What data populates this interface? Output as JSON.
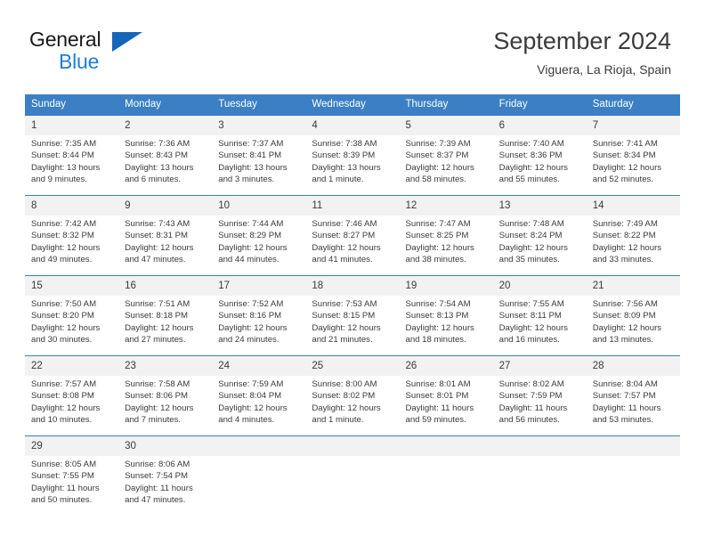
{
  "brand": {
    "name_part1": "General",
    "name_part2": "Blue",
    "triangle_color": "#1565b8",
    "blue_text_color": "#1f7fd4"
  },
  "header": {
    "title": "September 2024",
    "subtitle": "Viguera, La Rioja, Spain"
  },
  "theme": {
    "header_row_bg": "#3b7fc4",
    "day_number_bg": "#f2f2f2",
    "text_color": "#3a3a3a"
  },
  "calendar": {
    "weekday_headers": [
      "Sunday",
      "Monday",
      "Tuesday",
      "Wednesday",
      "Thursday",
      "Friday",
      "Saturday"
    ],
    "weeks": [
      [
        {
          "day": "1",
          "sunrise": "Sunrise: 7:35 AM",
          "sunset": "Sunset: 8:44 PM",
          "daylight_line1": "Daylight: 13 hours",
          "daylight_line2": "and 9 minutes."
        },
        {
          "day": "2",
          "sunrise": "Sunrise: 7:36 AM",
          "sunset": "Sunset: 8:43 PM",
          "daylight_line1": "Daylight: 13 hours",
          "daylight_line2": "and 6 minutes."
        },
        {
          "day": "3",
          "sunrise": "Sunrise: 7:37 AM",
          "sunset": "Sunset: 8:41 PM",
          "daylight_line1": "Daylight: 13 hours",
          "daylight_line2": "and 3 minutes."
        },
        {
          "day": "4",
          "sunrise": "Sunrise: 7:38 AM",
          "sunset": "Sunset: 8:39 PM",
          "daylight_line1": "Daylight: 13 hours",
          "daylight_line2": "and 1 minute."
        },
        {
          "day": "5",
          "sunrise": "Sunrise: 7:39 AM",
          "sunset": "Sunset: 8:37 PM",
          "daylight_line1": "Daylight: 12 hours",
          "daylight_line2": "and 58 minutes."
        },
        {
          "day": "6",
          "sunrise": "Sunrise: 7:40 AM",
          "sunset": "Sunset: 8:36 PM",
          "daylight_line1": "Daylight: 12 hours",
          "daylight_line2": "and 55 minutes."
        },
        {
          "day": "7",
          "sunrise": "Sunrise: 7:41 AM",
          "sunset": "Sunset: 8:34 PM",
          "daylight_line1": "Daylight: 12 hours",
          "daylight_line2": "and 52 minutes."
        }
      ],
      [
        {
          "day": "8",
          "sunrise": "Sunrise: 7:42 AM",
          "sunset": "Sunset: 8:32 PM",
          "daylight_line1": "Daylight: 12 hours",
          "daylight_line2": "and 49 minutes."
        },
        {
          "day": "9",
          "sunrise": "Sunrise: 7:43 AM",
          "sunset": "Sunset: 8:31 PM",
          "daylight_line1": "Daylight: 12 hours",
          "daylight_line2": "and 47 minutes."
        },
        {
          "day": "10",
          "sunrise": "Sunrise: 7:44 AM",
          "sunset": "Sunset: 8:29 PM",
          "daylight_line1": "Daylight: 12 hours",
          "daylight_line2": "and 44 minutes."
        },
        {
          "day": "11",
          "sunrise": "Sunrise: 7:46 AM",
          "sunset": "Sunset: 8:27 PM",
          "daylight_line1": "Daylight: 12 hours",
          "daylight_line2": "and 41 minutes."
        },
        {
          "day": "12",
          "sunrise": "Sunrise: 7:47 AM",
          "sunset": "Sunset: 8:25 PM",
          "daylight_line1": "Daylight: 12 hours",
          "daylight_line2": "and 38 minutes."
        },
        {
          "day": "13",
          "sunrise": "Sunrise: 7:48 AM",
          "sunset": "Sunset: 8:24 PM",
          "daylight_line1": "Daylight: 12 hours",
          "daylight_line2": "and 35 minutes."
        },
        {
          "day": "14",
          "sunrise": "Sunrise: 7:49 AM",
          "sunset": "Sunset: 8:22 PM",
          "daylight_line1": "Daylight: 12 hours",
          "daylight_line2": "and 33 minutes."
        }
      ],
      [
        {
          "day": "15",
          "sunrise": "Sunrise: 7:50 AM",
          "sunset": "Sunset: 8:20 PM",
          "daylight_line1": "Daylight: 12 hours",
          "daylight_line2": "and 30 minutes."
        },
        {
          "day": "16",
          "sunrise": "Sunrise: 7:51 AM",
          "sunset": "Sunset: 8:18 PM",
          "daylight_line1": "Daylight: 12 hours",
          "daylight_line2": "and 27 minutes."
        },
        {
          "day": "17",
          "sunrise": "Sunrise: 7:52 AM",
          "sunset": "Sunset: 8:16 PM",
          "daylight_line1": "Daylight: 12 hours",
          "daylight_line2": "and 24 minutes."
        },
        {
          "day": "18",
          "sunrise": "Sunrise: 7:53 AM",
          "sunset": "Sunset: 8:15 PM",
          "daylight_line1": "Daylight: 12 hours",
          "daylight_line2": "and 21 minutes."
        },
        {
          "day": "19",
          "sunrise": "Sunrise: 7:54 AM",
          "sunset": "Sunset: 8:13 PM",
          "daylight_line1": "Daylight: 12 hours",
          "daylight_line2": "and 18 minutes."
        },
        {
          "day": "20",
          "sunrise": "Sunrise: 7:55 AM",
          "sunset": "Sunset: 8:11 PM",
          "daylight_line1": "Daylight: 12 hours",
          "daylight_line2": "and 16 minutes."
        },
        {
          "day": "21",
          "sunrise": "Sunrise: 7:56 AM",
          "sunset": "Sunset: 8:09 PM",
          "daylight_line1": "Daylight: 12 hours",
          "daylight_line2": "and 13 minutes."
        }
      ],
      [
        {
          "day": "22",
          "sunrise": "Sunrise: 7:57 AM",
          "sunset": "Sunset: 8:08 PM",
          "daylight_line1": "Daylight: 12 hours",
          "daylight_line2": "and 10 minutes."
        },
        {
          "day": "23",
          "sunrise": "Sunrise: 7:58 AM",
          "sunset": "Sunset: 8:06 PM",
          "daylight_line1": "Daylight: 12 hours",
          "daylight_line2": "and 7 minutes."
        },
        {
          "day": "24",
          "sunrise": "Sunrise: 7:59 AM",
          "sunset": "Sunset: 8:04 PM",
          "daylight_line1": "Daylight: 12 hours",
          "daylight_line2": "and 4 minutes."
        },
        {
          "day": "25",
          "sunrise": "Sunrise: 8:00 AM",
          "sunset": "Sunset: 8:02 PM",
          "daylight_line1": "Daylight: 12 hours",
          "daylight_line2": "and 1 minute."
        },
        {
          "day": "26",
          "sunrise": "Sunrise: 8:01 AM",
          "sunset": "Sunset: 8:01 PM",
          "daylight_line1": "Daylight: 11 hours",
          "daylight_line2": "and 59 minutes."
        },
        {
          "day": "27",
          "sunrise": "Sunrise: 8:02 AM",
          "sunset": "Sunset: 7:59 PM",
          "daylight_line1": "Daylight: 11 hours",
          "daylight_line2": "and 56 minutes."
        },
        {
          "day": "28",
          "sunrise": "Sunrise: 8:04 AM",
          "sunset": "Sunset: 7:57 PM",
          "daylight_line1": "Daylight: 11 hours",
          "daylight_line2": "and 53 minutes."
        }
      ],
      [
        {
          "day": "29",
          "sunrise": "Sunrise: 8:05 AM",
          "sunset": "Sunset: 7:55 PM",
          "daylight_line1": "Daylight: 11 hours",
          "daylight_line2": "and 50 minutes."
        },
        {
          "day": "30",
          "sunrise": "Sunrise: 8:06 AM",
          "sunset": "Sunset: 7:54 PM",
          "daylight_line1": "Daylight: 11 hours",
          "daylight_line2": "and 47 minutes."
        },
        {
          "day": "",
          "sunrise": "",
          "sunset": "",
          "daylight_line1": "",
          "daylight_line2": ""
        },
        {
          "day": "",
          "sunrise": "",
          "sunset": "",
          "daylight_line1": "",
          "daylight_line2": ""
        },
        {
          "day": "",
          "sunrise": "",
          "sunset": "",
          "daylight_line1": "",
          "daylight_line2": ""
        },
        {
          "day": "",
          "sunrise": "",
          "sunset": "",
          "daylight_line1": "",
          "daylight_line2": ""
        },
        {
          "day": "",
          "sunrise": "",
          "sunset": "",
          "daylight_line1": "",
          "daylight_line2": ""
        }
      ]
    ]
  }
}
